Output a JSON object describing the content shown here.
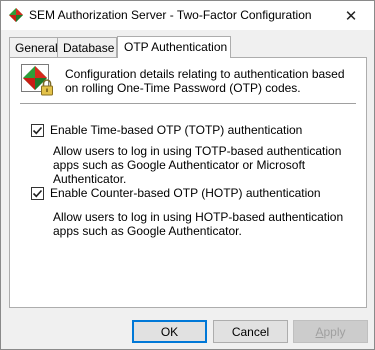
{
  "window": {
    "title": "SEM Authorization Server - Two-Factor Configuration",
    "close_label": "✕"
  },
  "tabs": [
    {
      "label": "General"
    },
    {
      "label": "Database"
    },
    {
      "label": "OTP Authentication",
      "selected": true
    }
  ],
  "header": {
    "description": "Configuration details relating to authentication based on rolling One-Time Password (OTP) codes."
  },
  "options": {
    "totp": {
      "label": "Enable Time-based OTP (TOTP) authentication",
      "checked": true,
      "description": "Allow users to log in using TOTP-based authentication apps such as Google Authenticator or Microsoft Authenticator."
    },
    "hotp": {
      "label": "Enable Counter-based OTP (HOTP) authentication",
      "checked": true,
      "description": "Allow users to log in using HOTP-based authentication apps such as Google Authenticator."
    }
  },
  "buttons": {
    "ok": "OK",
    "cancel": "Cancel",
    "apply_first": "A",
    "apply_rest": "pply"
  },
  "colors": {
    "accent": "#0078d7",
    "disabled_text": "#a0a0a0"
  },
  "icons": {
    "app": "diamond-app-icon",
    "header": "diamond-lock-icon",
    "close": "close-icon",
    "check": "checkmark-icon"
  }
}
